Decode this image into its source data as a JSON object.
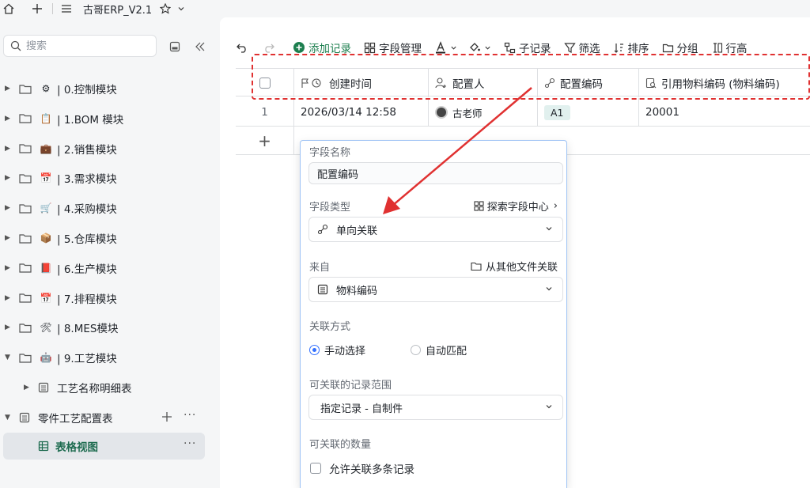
{
  "window": {
    "title": "古哥ERP_V2.1"
  },
  "sidebar": {
    "search_placeholder": "搜索",
    "items": [
      {
        "label": "| 0.控制模块",
        "emoji": "⚙",
        "expanded": false
      },
      {
        "label": "| 1.BOM 模块",
        "emoji": "📋",
        "expanded": false
      },
      {
        "label": "| 2.销售模块",
        "emoji": "💼",
        "expanded": false
      },
      {
        "label": "| 3.需求模块",
        "emoji": "📅",
        "expanded": false
      },
      {
        "label": "| 4.采购模块",
        "emoji": "🛒",
        "expanded": false
      },
      {
        "label": "| 5.仓库模块",
        "emoji": "📦",
        "expanded": false
      },
      {
        "label": "| 6.生产模块",
        "emoji": "📕",
        "expanded": false
      },
      {
        "label": "| 7.排程模块",
        "emoji": "📅",
        "expanded": false
      },
      {
        "label": "| 8.MES模块",
        "emoji": "🛠",
        "expanded": false
      },
      {
        "label": "| 9.工艺模块",
        "emoji": "🤖",
        "expanded": true
      }
    ],
    "sub_items": [
      {
        "label": "工艺名称明细表"
      },
      {
        "label": "零件工艺配置表"
      }
    ],
    "view": {
      "label": "表格视图"
    }
  },
  "toolbar": {
    "add_record": "添加记录",
    "field_manage": "字段管理",
    "sub_record": "子记录",
    "filter": "筛选",
    "sort": "排序",
    "group": "分组",
    "row_height": "行高"
  },
  "table": {
    "columns": [
      "创建时间",
      "配置人",
      "配置编码",
      "引用物料编码 (物料编码)"
    ],
    "rows": [
      {
        "index": "1",
        "created": "2026/03/14 12:58",
        "owner": "古老师",
        "code": "A1",
        "ref": "20001"
      }
    ],
    "add_row": "+"
  },
  "field_editor": {
    "name_label": "字段名称",
    "name_value": "配置编码",
    "type_label": "字段类型",
    "type_link": "探索字段中心",
    "type_value": "单向关联",
    "source_label": "来自",
    "source_link": "从其他文件关联",
    "source_value": "物料编码",
    "mode_label": "关联方式",
    "mode_manual": "手动选择",
    "mode_auto": "自动匹配",
    "mode_selected": "manual",
    "scope_label": "可关联的记录范围",
    "scope_value": "指定记录 - 自制件",
    "count_label": "可关联的数量",
    "count_option": "允许关联多条记录"
  },
  "colors": {
    "accent_green": "#1d7f4f",
    "annotation_red": "#e03131",
    "radio_blue": "#3370ff"
  }
}
